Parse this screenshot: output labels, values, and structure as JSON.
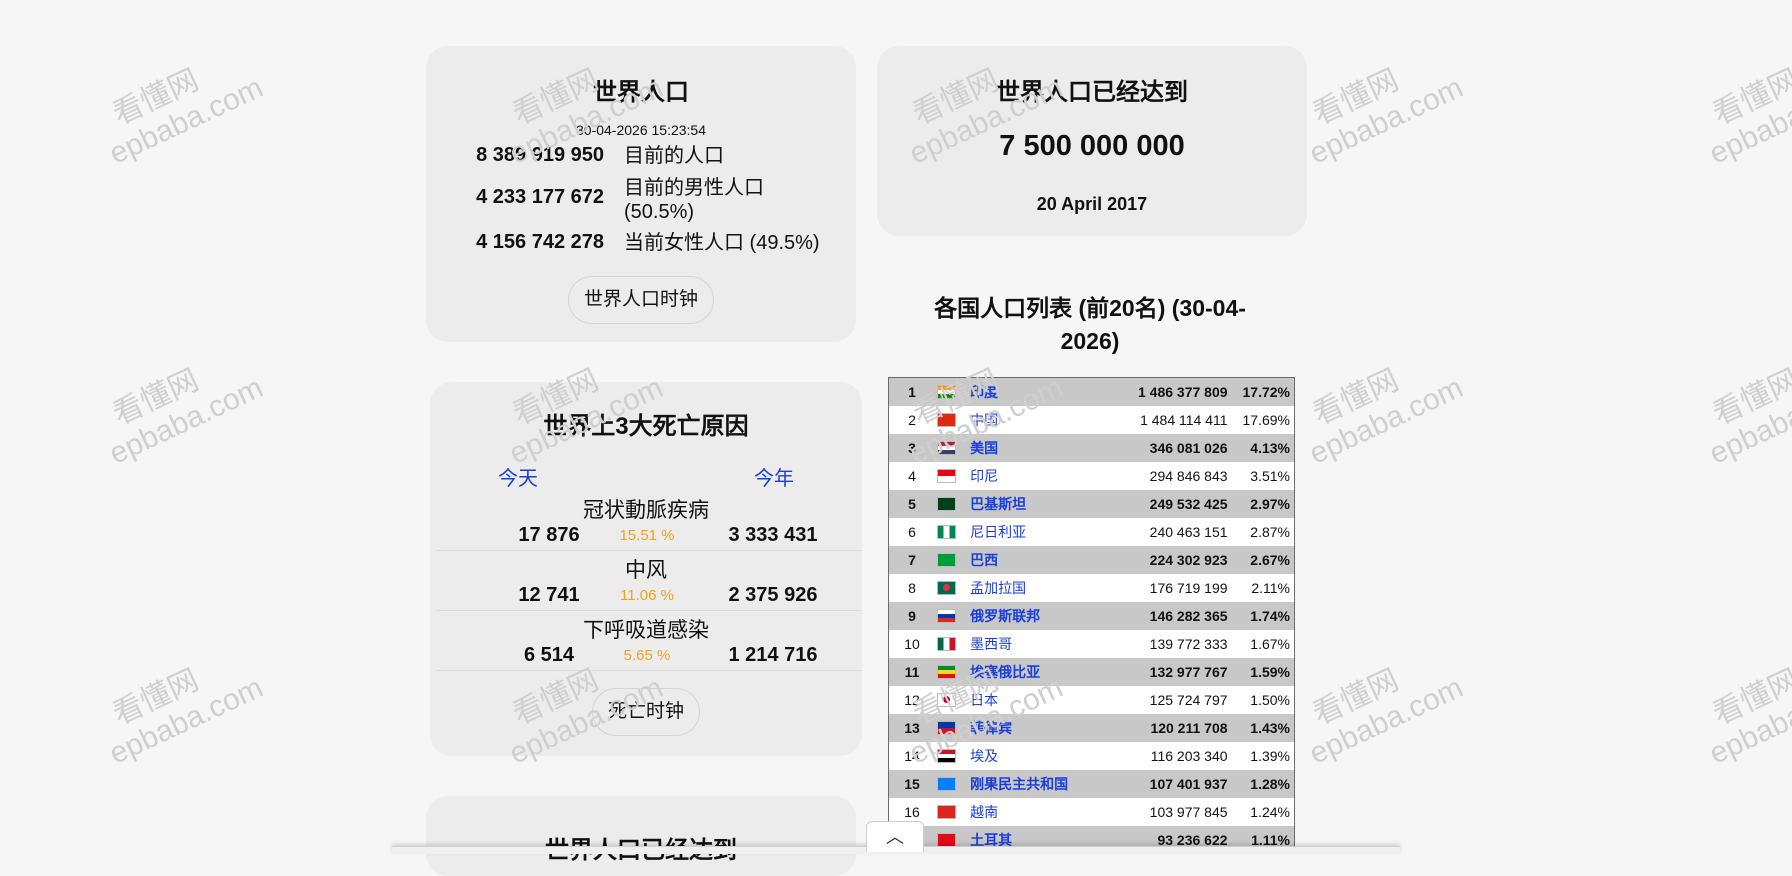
{
  "world_population": {
    "title": "世界人口",
    "timestamp": "30-04-2026 15:23:54",
    "rows": [
      {
        "value": "8 389 919 950",
        "label": "目前的人口"
      },
      {
        "value": "4 233 177 672",
        "label": "目前的男性人口 (50.5%)"
      },
      {
        "value": "4 156 742 278",
        "label": "当前女性人口 (49.5%)"
      }
    ],
    "clock_button": "世界人口时钟"
  },
  "milestone": {
    "title": "世界人口已经达到",
    "value": "7 500 000 000",
    "date": "20 April 2017"
  },
  "death_causes": {
    "title": "世界上3大死亡原因",
    "today_label": "今天",
    "year_label": "今年",
    "causes": [
      {
        "name": "冠状動脈疾病",
        "today": "17 876",
        "pct": "15.51 %",
        "year": "3 333 431"
      },
      {
        "name": "中风",
        "today": "12 741",
        "pct": "11.06 %",
        "year": "2 375 926"
      },
      {
        "name": "下呼吸道感染",
        "today": "6 514",
        "pct": "5.65 %",
        "year": "1 214 716"
      }
    ],
    "clock_button": "死亡时钟"
  },
  "milestone2": {
    "title": "世界人口已经达到"
  },
  "country_list": {
    "title": "各国人口列表 (前20名) (30-04-2026)",
    "rows": [
      {
        "rank": "1",
        "flag": "flag-india",
        "name": "印度",
        "pop": "1 486 377 809",
        "pct": "17.72%"
      },
      {
        "rank": "2",
        "flag": "flag-china",
        "name": "中国",
        "pop": "1 484 114 411",
        "pct": "17.69%"
      },
      {
        "rank": "3",
        "flag": "flag-usa",
        "name": "美国",
        "pop": "346 081 026",
        "pct": "4.13%"
      },
      {
        "rank": "4",
        "flag": "flag-indonesia",
        "name": "印尼",
        "pop": "294 846 843",
        "pct": "3.51%"
      },
      {
        "rank": "5",
        "flag": "flag-pakistan",
        "name": "巴基斯坦",
        "pop": "249 532 425",
        "pct": "2.97%"
      },
      {
        "rank": "6",
        "flag": "flag-nigeria",
        "name": "尼日利亚",
        "pop": "240 463 151",
        "pct": "2.87%"
      },
      {
        "rank": "7",
        "flag": "flag-brazil",
        "name": "巴西",
        "pop": "224 302 923",
        "pct": "2.67%"
      },
      {
        "rank": "8",
        "flag": "flag-bangladesh",
        "name": "孟加拉国",
        "pop": "176 719 199",
        "pct": "2.11%"
      },
      {
        "rank": "9",
        "flag": "flag-russia",
        "name": "俄罗斯联邦",
        "pop": "146 282 365",
        "pct": "1.74%"
      },
      {
        "rank": "10",
        "flag": "flag-mexico",
        "name": "墨西哥",
        "pop": "139 772 333",
        "pct": "1.67%"
      },
      {
        "rank": "11",
        "flag": "flag-ethiopia",
        "name": "埃塞俄比亚",
        "pop": "132 977 767",
        "pct": "1.59%"
      },
      {
        "rank": "12",
        "flag": "flag-japan",
        "name": "日本",
        "pop": "125 724 797",
        "pct": "1.50%"
      },
      {
        "rank": "13",
        "flag": "flag-philippines",
        "name": "菲律宾",
        "pop": "120 211 708",
        "pct": "1.43%"
      },
      {
        "rank": "14",
        "flag": "flag-egypt",
        "name": "埃及",
        "pop": "116 203 340",
        "pct": "1.39%"
      },
      {
        "rank": "15",
        "flag": "flag-dr-congo",
        "name": "刚果民主共和国",
        "pop": "107 401 937",
        "pct": "1.28%"
      },
      {
        "rank": "16",
        "flag": "flag-vietnam",
        "name": "越南",
        "pop": "103 977 845",
        "pct": "1.24%"
      },
      {
        "rank": "17",
        "flag": "flag-turkey",
        "name": "土耳其",
        "pop": "93 236 622",
        "pct": "1.11%"
      }
    ]
  },
  "watermark": {
    "line1": "看懂网",
    "line2": "epbaba.com"
  },
  "scroll_up_icon": "chevron-up-icon",
  "colors": {
    "link": "#1a3ed8",
    "percent": "#f0a21b",
    "card": "#ececec",
    "row_shade": "#c8c8c8"
  }
}
